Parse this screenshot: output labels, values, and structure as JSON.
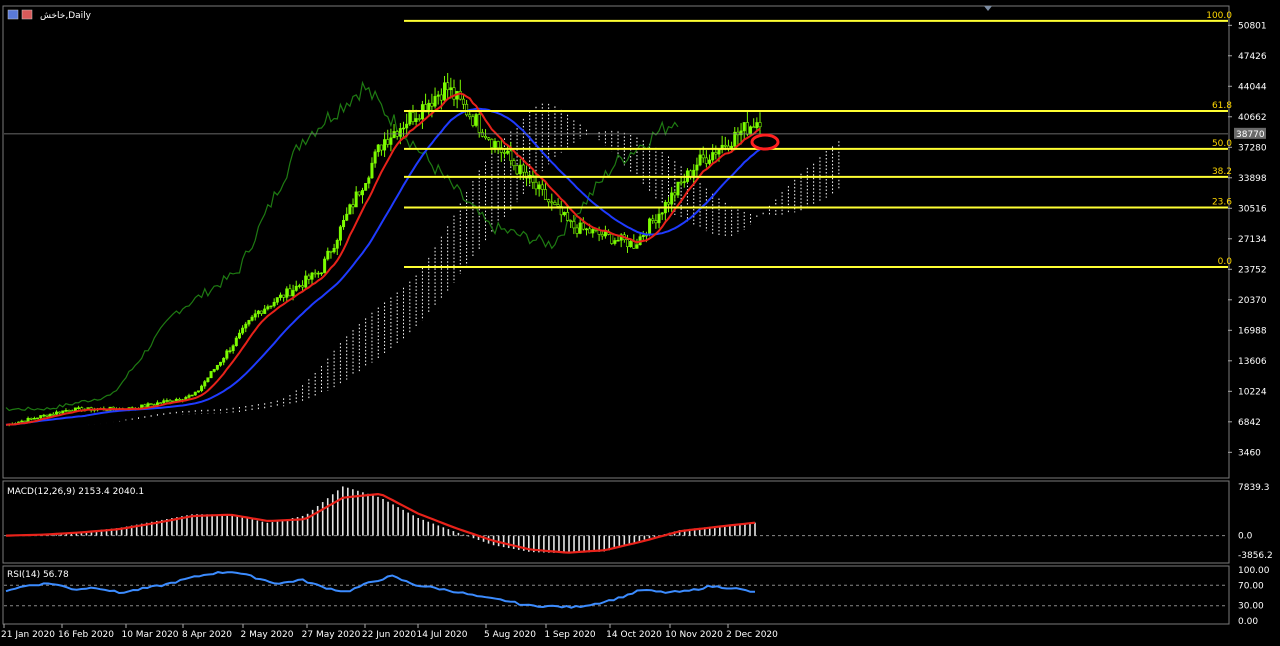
{
  "window": {
    "symbol_title": "خاخش,Daily",
    "macd_title": "MACD(12,26,9) 2153.4 2040.1",
    "rsi_title": "RSI(14) 56.78"
  },
  "colors": {
    "background": "#000000",
    "bull_candle": "#7CFC00",
    "tenkan": "#e8221a",
    "kijun": "#1f3bff",
    "chikou": "#1e7a12",
    "kumo": "#ffffff",
    "fib": "#ffff33",
    "macd_hist": "#e6e6e6",
    "macd_signal": "#e8221a",
    "rsi": "#3c8cff",
    "highlight": "#ff2020"
  },
  "chart_data": [
    {
      "type": "candlestick",
      "name": "price",
      "price_axis": [
        50801,
        47426,
        44044,
        40662,
        37280,
        33898,
        30516,
        27134,
        23752,
        20370,
        16988,
        13606,
        10224,
        6842,
        3460
      ],
      "current_price_label": "38770",
      "ylim": [
        1500,
        52500
      ],
      "date_labels": [
        "21 Jan 2020",
        "16 Feb 2020",
        "10 Mar 2020",
        "8 Apr 2020",
        "2 May 2020",
        "27 May 2020",
        "22 Jun 2020",
        "14 Jul 2020",
        "5 Aug 2020",
        "1 Sep 2020",
        "14 Oct 2020",
        "10 Nov 2020",
        "2 Dec 2020"
      ],
      "close_approx": {
        "dates": [
          "21 Jan 2020",
          "16 Feb 2020",
          "10 Mar 2020",
          "8 Apr 2020",
          "2 May 2020",
          "27 May 2020",
          "22 Jun 2020",
          "14 Jul 2020",
          "5 Aug 2020",
          "1 Sep 2020",
          "14 Oct 2020",
          "10 Nov 2020",
          "2 Dec 2020"
        ],
        "values": [
          6500,
          8200,
          8300,
          9800,
          19000,
          23500,
          38000,
          44000,
          36000,
          28500,
          26500,
          35500,
          40500
        ]
      },
      "fibonacci": [
        {
          "level": "100.0",
          "price": 51300
        },
        {
          "level": "61.8",
          "price": 41300
        },
        {
          "level": "50.0",
          "price": 37100
        },
        {
          "level": "38.2",
          "price": 34000
        },
        {
          "level": "23.6",
          "price": 30600
        },
        {
          "level": "0.0",
          "price": 24000
        }
      ]
    },
    {
      "type": "bar+line",
      "name": "macd",
      "axis_labels": [
        "7839.3",
        "0.0",
        "-3856.2"
      ],
      "ylim": [
        -3856.2,
        7839.3
      ],
      "histogram": [
        0,
        200,
        600,
        1200,
        2300,
        3400,
        3300,
        2000,
        3200,
        7800,
        6000,
        2800,
        600,
        -1500,
        -2600,
        -2800,
        -2500,
        -700,
        900,
        1500,
        2050
      ],
      "signal": [
        0,
        150,
        500,
        1000,
        2000,
        3100,
        3300,
        2300,
        2600,
        6000,
        6600,
        3500,
        1200,
        -800,
        -2200,
        -2700,
        -2300,
        -900,
        700,
        1400,
        2040
      ]
    },
    {
      "type": "line",
      "name": "rsi",
      "axis_labels": [
        "100.00",
        "70.00",
        "30.00",
        "0.00"
      ],
      "ylim": [
        0,
        100
      ],
      "values": [
        60,
        70,
        74,
        62,
        66,
        55,
        63,
        71,
        83,
        93,
        97,
        85,
        73,
        81,
        66,
        57,
        75,
        88,
        71,
        64,
        56,
        46,
        40,
        30,
        29,
        27,
        34,
        45,
        61,
        56,
        58,
        68,
        65,
        56
      ]
    }
  ]
}
